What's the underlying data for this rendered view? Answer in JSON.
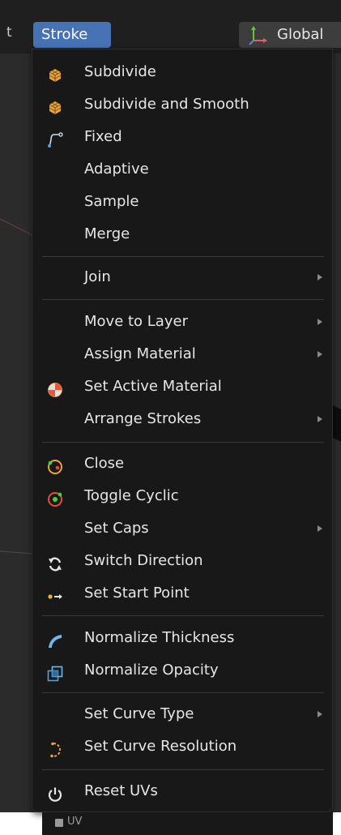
{
  "header": {
    "left_fragment": "t",
    "active_menu": "Stroke",
    "orientation_label": "Global"
  },
  "menu": {
    "items": [
      {
        "label": "Subdivide",
        "icon": "subdivide-icon"
      },
      {
        "label": "Subdivide and Smooth",
        "icon": "subdivide-smooth-icon"
      },
      {
        "label": "Fixed",
        "icon": "fixed-curve-icon"
      },
      {
        "label": "Adaptive"
      },
      {
        "label": "Sample"
      },
      {
        "label": "Merge"
      },
      {
        "label": "Join",
        "submenu": true
      },
      {
        "label": "Move to Layer",
        "submenu": true
      },
      {
        "label": "Assign Material",
        "submenu": true
      },
      {
        "label": "Set Active Material",
        "icon": "material-icon"
      },
      {
        "label": "Arrange Strokes",
        "submenu": true
      },
      {
        "label": "Close",
        "icon": "close-stroke-icon"
      },
      {
        "label": "Toggle Cyclic",
        "icon": "toggle-cyclic-icon"
      },
      {
        "label": "Set Caps",
        "submenu": true
      },
      {
        "label": "Switch Direction",
        "icon": "switch-direction-icon"
      },
      {
        "label": "Set Start Point",
        "icon": "start-point-icon"
      },
      {
        "label": "Normalize Thickness",
        "icon": "thickness-icon"
      },
      {
        "label": "Normalize Opacity",
        "icon": "opacity-icon"
      },
      {
        "label": "Set Curve Type",
        "submenu": true
      },
      {
        "label": "Set Curve Resolution",
        "icon": "curve-resolution-icon"
      },
      {
        "label": "Reset UVs",
        "icon": "power-icon"
      }
    ]
  },
  "bottom": {
    "uv_label": "UV"
  },
  "colors": {
    "menu_bg": "#181818",
    "highlight": "#4772b3",
    "text": "#e6e6e6",
    "icon_orange": "#e8a33a",
    "icon_blue": "#4aa3df",
    "icon_green": "#3fd33f"
  }
}
